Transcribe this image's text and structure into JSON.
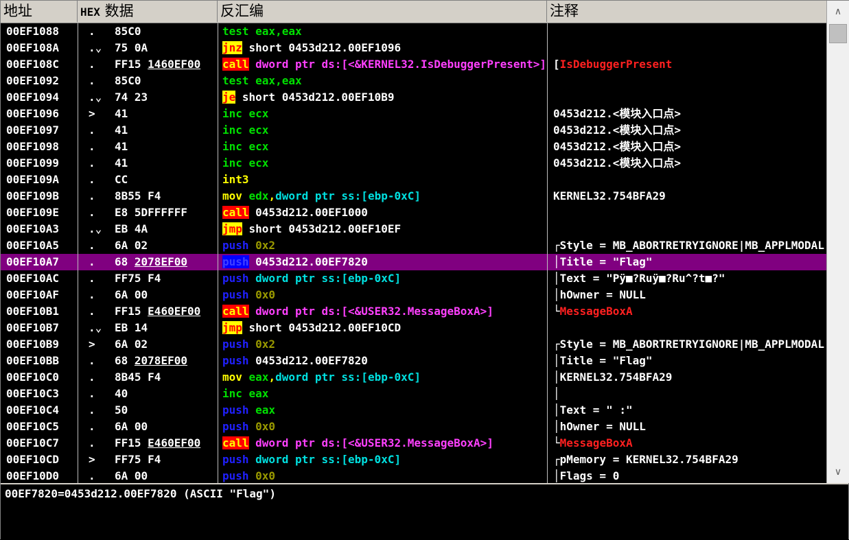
{
  "header": {
    "addr": "地址",
    "hex_tag": "HEX",
    "hex_title": "数据",
    "disasm": "反汇编",
    "comment": "注释"
  },
  "rows": [
    {
      "addr": "00EF1088",
      "mark": ".",
      "hex": [
        {
          "t": "85C0"
        }
      ],
      "dis": [
        {
          "t": "test eax,eax",
          "c": "gr"
        }
      ],
      "cmt": []
    },
    {
      "addr": "00EF108A",
      "mark": ".⌄",
      "hex": [
        {
          "t": "75 0A"
        }
      ],
      "dis": [
        {
          "t": "jnz",
          "c": "hl-jmp"
        },
        {
          "t": " short 0453d212.00EF1096",
          "c": "w"
        }
      ],
      "cmt": []
    },
    {
      "addr": "00EF108C",
      "mark": ".",
      "hex": [
        {
          "t": "FF15 "
        },
        {
          "t": "1460EF00",
          "u": true
        }
      ],
      "dis": [
        {
          "t": "call",
          "c": "hl-call"
        },
        {
          "t": " dword ptr ds:[<&KERNEL32.IsDebuggerPresent>]",
          "c": "mg"
        }
      ],
      "cmt": [
        {
          "t": "[",
          "c": "w"
        },
        {
          "t": "IsDebuggerPresent",
          "c": "rd"
        }
      ]
    },
    {
      "addr": "00EF1092",
      "mark": ".",
      "hex": [
        {
          "t": "85C0"
        }
      ],
      "dis": [
        {
          "t": "test eax,eax",
          "c": "gr"
        }
      ],
      "cmt": []
    },
    {
      "addr": "00EF1094",
      "mark": ".⌄",
      "hex": [
        {
          "t": "74 23"
        }
      ],
      "dis": [
        {
          "t": "je",
          "c": "hl-jmp"
        },
        {
          "t": " short 0453d212.00EF10B9",
          "c": "w"
        }
      ],
      "cmt": []
    },
    {
      "addr": "00EF1096",
      "mark": ">",
      "hex": [
        {
          "t": "41"
        }
      ],
      "dis": [
        {
          "t": "inc ecx",
          "c": "gr"
        }
      ],
      "cmt": [
        {
          "t": " 0453d212.<模块入口点>",
          "c": "w"
        }
      ]
    },
    {
      "addr": "00EF1097",
      "mark": ".",
      "hex": [
        {
          "t": "41"
        }
      ],
      "dis": [
        {
          "t": "inc ecx",
          "c": "gr"
        }
      ],
      "cmt": [
        {
          "t": " 0453d212.<模块入口点>",
          "c": "w"
        }
      ]
    },
    {
      "addr": "00EF1098",
      "mark": ".",
      "hex": [
        {
          "t": "41"
        }
      ],
      "dis": [
        {
          "t": "inc ecx",
          "c": "gr"
        }
      ],
      "cmt": [
        {
          "t": " 0453d212.<模块入口点>",
          "c": "w"
        }
      ]
    },
    {
      "addr": "00EF1099",
      "mark": ".",
      "hex": [
        {
          "t": "41"
        }
      ],
      "dis": [
        {
          "t": "inc ecx",
          "c": "gr"
        }
      ],
      "cmt": [
        {
          "t": " 0453d212.<模块入口点>",
          "c": "w"
        }
      ]
    },
    {
      "addr": "00EF109A",
      "mark": ".",
      "hex": [
        {
          "t": "CC"
        }
      ],
      "dis": [
        {
          "t": "int3",
          "c": "ye"
        }
      ],
      "cmt": []
    },
    {
      "addr": "00EF109B",
      "mark": ".",
      "hex": [
        {
          "t": "8B55 F4"
        }
      ],
      "dis": [
        {
          "t": "mov ",
          "c": "ye"
        },
        {
          "t": "edx",
          "c": "gr"
        },
        {
          "t": ",",
          "c": "ye"
        },
        {
          "t": "dword ptr ss:[ebp-0xC]",
          "c": "cy"
        }
      ],
      "cmt": [
        {
          "t": " KERNEL32.754BFA29",
          "c": "w"
        }
      ]
    },
    {
      "addr": "00EF109E",
      "mark": ".",
      "hex": [
        {
          "t": "E8 5DFFFFFF"
        }
      ],
      "dis": [
        {
          "t": "call",
          "c": "hl-call"
        },
        {
          "t": " 0453d212.00EF1000",
          "c": "w"
        }
      ],
      "cmt": []
    },
    {
      "addr": "00EF10A3",
      "mark": ".⌄",
      "hex": [
        {
          "t": "EB 4A"
        }
      ],
      "dis": [
        {
          "t": "jmp",
          "c": "hl-jmp"
        },
        {
          "t": " short 0453d212.00EF10EF",
          "c": "w"
        }
      ],
      "cmt": []
    },
    {
      "addr": "00EF10A5",
      "mark": ".",
      "hex": [
        {
          "t": "6A 02"
        }
      ],
      "dis": [
        {
          "t": "push",
          "c": "bl"
        },
        {
          "t": " 0x2",
          "c": "ol"
        }
      ],
      "cmt": [
        {
          "t": "┌Style = MB_ABORTRETRYIGNORE|MB_APPLMODAL",
          "c": "w"
        }
      ]
    },
    {
      "addr": "00EF10A7",
      "mark": ".",
      "hex": [
        {
          "t": "68 "
        },
        {
          "t": "2078EF00",
          "u": true
        }
      ],
      "dis": [
        {
          "t": "push",
          "c": "hl-push"
        },
        {
          "t": " 0453d212.00EF7820",
          "c": "w"
        }
      ],
      "cmt": [
        {
          "t": "│Title = \"Flag\"",
          "c": "w"
        }
      ],
      "sel": true
    },
    {
      "addr": "00EF10AC",
      "mark": ".",
      "hex": [
        {
          "t": "FF75 F4"
        }
      ],
      "dis": [
        {
          "t": "push",
          "c": "bl"
        },
        {
          "t": " dword ptr ss:[ebp-0xC]",
          "c": "cy"
        }
      ],
      "cmt": [
        {
          "t": "│Text = \"Pÿ■?Ruÿ■?Ru^?t■?\"",
          "c": "w"
        }
      ]
    },
    {
      "addr": "00EF10AF",
      "mark": ".",
      "hex": [
        {
          "t": "6A 00"
        }
      ],
      "dis": [
        {
          "t": "push",
          "c": "bl"
        },
        {
          "t": " 0x0",
          "c": "ol"
        }
      ],
      "cmt": [
        {
          "t": "│hOwner = NULL",
          "c": "w"
        }
      ]
    },
    {
      "addr": "00EF10B1",
      "mark": ".",
      "hex": [
        {
          "t": "FF15 "
        },
        {
          "t": "E460EF00",
          "u": true
        }
      ],
      "dis": [
        {
          "t": "call",
          "c": "hl-call"
        },
        {
          "t": " dword ptr ds:[<&USER32.MessageBoxA>]",
          "c": "mg"
        }
      ],
      "cmt": [
        {
          "t": "└",
          "c": "w"
        },
        {
          "t": "MessageBoxA",
          "c": "rd"
        }
      ]
    },
    {
      "addr": "00EF10B7",
      "mark": ".⌄",
      "hex": [
        {
          "t": "EB 14"
        }
      ],
      "dis": [
        {
          "t": "jmp",
          "c": "hl-jmp"
        },
        {
          "t": " short 0453d212.00EF10CD",
          "c": "w"
        }
      ],
      "cmt": []
    },
    {
      "addr": "00EF10B9",
      "mark": ">",
      "hex": [
        {
          "t": "6A 02"
        }
      ],
      "dis": [
        {
          "t": "push",
          "c": "bl"
        },
        {
          "t": " 0x2",
          "c": "ol"
        }
      ],
      "cmt": [
        {
          "t": "┌Style = MB_ABORTRETRYIGNORE|MB_APPLMODAL",
          "c": "w"
        }
      ]
    },
    {
      "addr": "00EF10BB",
      "mark": ".",
      "hex": [
        {
          "t": "68 "
        },
        {
          "t": "2078EF00",
          "u": true
        }
      ],
      "dis": [
        {
          "t": "push",
          "c": "bl"
        },
        {
          "t": " 0453d212.00EF7820",
          "c": "w"
        }
      ],
      "cmt": [
        {
          "t": "│Title = \"Flag\"",
          "c": "w"
        }
      ]
    },
    {
      "addr": "00EF10C0",
      "mark": ".",
      "hex": [
        {
          "t": "8B45 F4"
        }
      ],
      "dis": [
        {
          "t": "mov ",
          "c": "ye"
        },
        {
          "t": "eax",
          "c": "gr"
        },
        {
          "t": ",",
          "c": "ye"
        },
        {
          "t": "dword ptr ss:[ebp-0xC]",
          "c": "cy"
        }
      ],
      "cmt": [
        {
          "t": "│KERNEL32.754BFA29",
          "c": "w"
        }
      ]
    },
    {
      "addr": "00EF10C3",
      "mark": ".",
      "hex": [
        {
          "t": "40"
        }
      ],
      "dis": [
        {
          "t": "inc eax",
          "c": "gr"
        }
      ],
      "cmt": [
        {
          "t": "│",
          "c": "w"
        }
      ]
    },
    {
      "addr": "00EF10C4",
      "mark": ".",
      "hex": [
        {
          "t": "50"
        }
      ],
      "dis": [
        {
          "t": "push",
          "c": "bl"
        },
        {
          "t": " eax",
          "c": "gr"
        }
      ],
      "cmt": [
        {
          "t": "│Text = \"  :\"",
          "c": "w"
        }
      ]
    },
    {
      "addr": "00EF10C5",
      "mark": ".",
      "hex": [
        {
          "t": "6A 00"
        }
      ],
      "dis": [
        {
          "t": "push",
          "c": "bl"
        },
        {
          "t": " 0x0",
          "c": "ol"
        }
      ],
      "cmt": [
        {
          "t": "│hOwner = NULL",
          "c": "w"
        }
      ]
    },
    {
      "addr": "00EF10C7",
      "mark": ".",
      "hex": [
        {
          "t": "FF15 "
        },
        {
          "t": "E460EF00",
          "u": true
        }
      ],
      "dis": [
        {
          "t": "call",
          "c": "hl-call"
        },
        {
          "t": " dword ptr ds:[<&USER32.MessageBoxA>]",
          "c": "mg"
        }
      ],
      "cmt": [
        {
          "t": "└",
          "c": "w"
        },
        {
          "t": "MessageBoxA",
          "c": "rd"
        }
      ]
    },
    {
      "addr": "00EF10CD",
      "mark": ">",
      "hex": [
        {
          "t": "FF75 F4"
        }
      ],
      "dis": [
        {
          "t": "push",
          "c": "bl"
        },
        {
          "t": " dword ptr ss:[ebp-0xC]",
          "c": "cy"
        }
      ],
      "cmt": [
        {
          "t": "┌pMemory = KERNEL32.754BFA29",
          "c": "w"
        }
      ]
    },
    {
      "addr": "00EF10D0",
      "mark": ".",
      "hex": [
        {
          "t": "6A 00"
        }
      ],
      "dis": [
        {
          "t": "push",
          "c": "bl"
        },
        {
          "t": " 0x0",
          "c": "ol"
        }
      ],
      "cmt": [
        {
          "t": "│Flags = 0",
          "c": "w"
        }
      ]
    }
  ],
  "status": "00EF7820=0453d212.00EF7820 (ASCII \"Flag\")",
  "scrollbar": {
    "up_icon": "chevron-up-icon",
    "down_icon": "chevron-down-icon"
  },
  "colors": {
    "selection": "#800080",
    "call_bg": "#ff0000",
    "jmp_bg": "#ffff00",
    "push_bg": "#0000ff"
  }
}
